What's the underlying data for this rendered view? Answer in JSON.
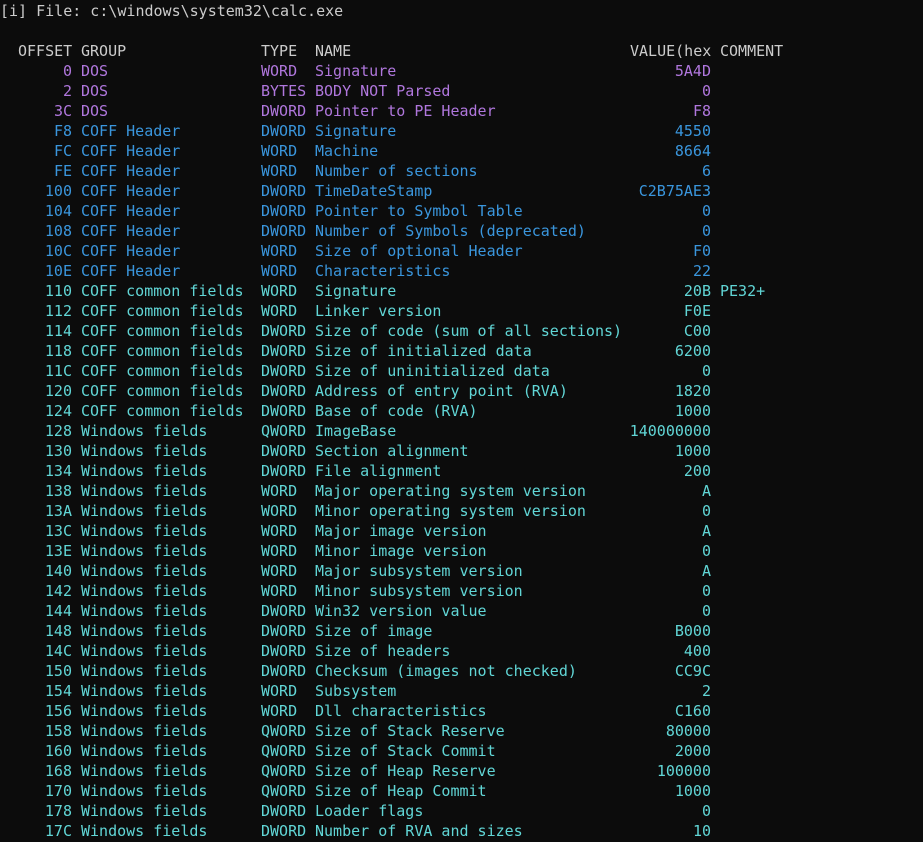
{
  "window": {
    "title": "[i] File: c:\\windows\\system32\\calc.exe"
  },
  "colors": {
    "background": "#0c0c0c",
    "header_text": "#cccccc",
    "dos_section": "#b077dd",
    "coff_section": "#3a96dd",
    "optional_section": "#61d6d6"
  },
  "table": {
    "headers": {
      "offset": "OFFSET",
      "group": "GROUP",
      "type": "TYPE",
      "name": "NAME",
      "value": "VALUE(hex",
      "comment": "COMMENT"
    },
    "rows": [
      {
        "offset": "0",
        "group": "DOS",
        "type": "WORD",
        "name": "Signature",
        "value": "5A4D",
        "comment": "",
        "color": "#b077dd"
      },
      {
        "offset": "2",
        "group": "DOS",
        "type": "BYTES",
        "name": "BODY NOT Parsed",
        "value": "0",
        "comment": "",
        "color": "#b077dd"
      },
      {
        "offset": "3C",
        "group": "DOS",
        "type": "DWORD",
        "name": "Pointer to PE Header",
        "value": "F8",
        "comment": "",
        "color": "#b077dd"
      },
      {
        "offset": "F8",
        "group": "COFF Header",
        "type": "DWORD",
        "name": "Signature",
        "value": "4550",
        "comment": "",
        "color": "#3a96dd"
      },
      {
        "offset": "FC",
        "group": "COFF Header",
        "type": "WORD",
        "name": "Machine",
        "value": "8664",
        "comment": "",
        "color": "#3a96dd"
      },
      {
        "offset": "FE",
        "group": "COFF Header",
        "type": "WORD",
        "name": "Number of sections",
        "value": "6",
        "comment": "",
        "color": "#3a96dd"
      },
      {
        "offset": "100",
        "group": "COFF Header",
        "type": "DWORD",
        "name": "TimeDateStamp",
        "value": "C2B75AE3",
        "comment": "",
        "color": "#3a96dd"
      },
      {
        "offset": "104",
        "group": "COFF Header",
        "type": "DWORD",
        "name": "Pointer to Symbol Table",
        "value": "0",
        "comment": "",
        "color": "#3a96dd"
      },
      {
        "offset": "108",
        "group": "COFF Header",
        "type": "DWORD",
        "name": "Number of Symbols (deprecated)",
        "value": "0",
        "comment": "",
        "color": "#3a96dd"
      },
      {
        "offset": "10C",
        "group": "COFF Header",
        "type": "WORD",
        "name": "Size of optional Header",
        "value": "F0",
        "comment": "",
        "color": "#3a96dd"
      },
      {
        "offset": "10E",
        "group": "COFF Header",
        "type": "WORD",
        "name": "Characteristics",
        "value": "22",
        "comment": "",
        "color": "#3a96dd"
      },
      {
        "offset": "110",
        "group": "COFF common fields",
        "type": "WORD",
        "name": "Signature",
        "value": "20B",
        "comment": "PE32+",
        "color": "#61d6d6"
      },
      {
        "offset": "112",
        "group": "COFF common fields",
        "type": "WORD",
        "name": "Linker version",
        "value": "F0E",
        "comment": "",
        "color": "#61d6d6"
      },
      {
        "offset": "114",
        "group": "COFF common fields",
        "type": "DWORD",
        "name": "Size of code (sum of all sections)",
        "value": "C00",
        "comment": "",
        "color": "#61d6d6"
      },
      {
        "offset": "118",
        "group": "COFF common fields",
        "type": "DWORD",
        "name": "Size of initialized data",
        "value": "6200",
        "comment": "",
        "color": "#61d6d6"
      },
      {
        "offset": "11C",
        "group": "COFF common fields",
        "type": "DWORD",
        "name": "Size of uninitialized data",
        "value": "0",
        "comment": "",
        "color": "#61d6d6"
      },
      {
        "offset": "120",
        "group": "COFF common fields",
        "type": "DWORD",
        "name": "Address of entry point (RVA)",
        "value": "1820",
        "comment": "",
        "color": "#61d6d6"
      },
      {
        "offset": "124",
        "group": "COFF common fields",
        "type": "DWORD",
        "name": "Base of code (RVA)",
        "value": "1000",
        "comment": "",
        "color": "#61d6d6"
      },
      {
        "offset": "128",
        "group": "Windows fields",
        "type": "QWORD",
        "name": "ImageBase",
        "value": "140000000",
        "comment": "",
        "color": "#61d6d6"
      },
      {
        "offset": "130",
        "group": "Windows fields",
        "type": "DWORD",
        "name": "Section alignment",
        "value": "1000",
        "comment": "",
        "color": "#61d6d6"
      },
      {
        "offset": "134",
        "group": "Windows fields",
        "type": "DWORD",
        "name": "File alignment",
        "value": "200",
        "comment": "",
        "color": "#61d6d6"
      },
      {
        "offset": "138",
        "group": "Windows fields",
        "type": "WORD",
        "name": "Major operating system version",
        "value": "A",
        "comment": "",
        "color": "#61d6d6"
      },
      {
        "offset": "13A",
        "group": "Windows fields",
        "type": "WORD",
        "name": "Minor operating system version",
        "value": "0",
        "comment": "",
        "color": "#61d6d6"
      },
      {
        "offset": "13C",
        "group": "Windows fields",
        "type": "WORD",
        "name": "Major image version",
        "value": "A",
        "comment": "",
        "color": "#61d6d6"
      },
      {
        "offset": "13E",
        "group": "Windows fields",
        "type": "WORD",
        "name": "Minor image version",
        "value": "0",
        "comment": "",
        "color": "#61d6d6"
      },
      {
        "offset": "140",
        "group": "Windows fields",
        "type": "WORD",
        "name": "Major subsystem version",
        "value": "A",
        "comment": "",
        "color": "#61d6d6"
      },
      {
        "offset": "142",
        "group": "Windows fields",
        "type": "WORD",
        "name": "Minor subsystem version",
        "value": "0",
        "comment": "",
        "color": "#61d6d6"
      },
      {
        "offset": "144",
        "group": "Windows fields",
        "type": "DWORD",
        "name": "Win32 version value",
        "value": "0",
        "comment": "",
        "color": "#61d6d6"
      },
      {
        "offset": "148",
        "group": "Windows fields",
        "type": "DWORD",
        "name": "Size of image",
        "value": "B000",
        "comment": "",
        "color": "#61d6d6"
      },
      {
        "offset": "14C",
        "group": "Windows fields",
        "type": "DWORD",
        "name": "Size of headers",
        "value": "400",
        "comment": "",
        "color": "#61d6d6"
      },
      {
        "offset": "150",
        "group": "Windows fields",
        "type": "DWORD",
        "name": "Checksum (images not checked)",
        "value": "CC9C",
        "comment": "",
        "color": "#61d6d6"
      },
      {
        "offset": "154",
        "group": "Windows fields",
        "type": "WORD",
        "name": "Subsystem",
        "value": "2",
        "comment": "",
        "color": "#61d6d6"
      },
      {
        "offset": "156",
        "group": "Windows fields",
        "type": "WORD",
        "name": "Dll characteristics",
        "value": "C160",
        "comment": "",
        "color": "#61d6d6"
      },
      {
        "offset": "158",
        "group": "Windows fields",
        "type": "QWORD",
        "name": "Size of Stack Reserve",
        "value": "80000",
        "comment": "",
        "color": "#61d6d6"
      },
      {
        "offset": "160",
        "group": "Windows fields",
        "type": "QWORD",
        "name": "Size of Stack Commit",
        "value": "2000",
        "comment": "",
        "color": "#61d6d6"
      },
      {
        "offset": "168",
        "group": "Windows fields",
        "type": "QWORD",
        "name": "Size of Heap Reserve",
        "value": "100000",
        "comment": "",
        "color": "#61d6d6"
      },
      {
        "offset": "170",
        "group": "Windows fields",
        "type": "QWORD",
        "name": "Size of Heap Commit",
        "value": "1000",
        "comment": "",
        "color": "#61d6d6"
      },
      {
        "offset": "178",
        "group": "Windows fields",
        "type": "DWORD",
        "name": "Loader flags",
        "value": "0",
        "comment": "",
        "color": "#61d6d6"
      },
      {
        "offset": "17C",
        "group": "Windows fields",
        "type": "DWORD",
        "name": "Number of RVA and sizes",
        "value": "10",
        "comment": "",
        "color": "#61d6d6"
      }
    ]
  }
}
